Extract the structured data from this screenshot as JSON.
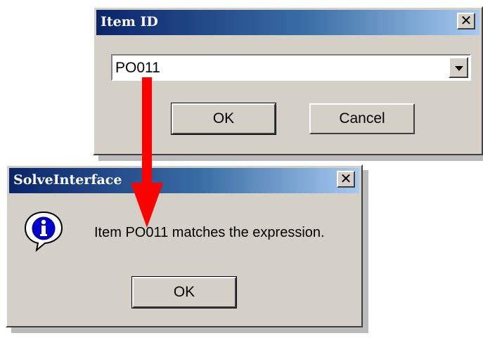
{
  "item_dialog": {
    "title": "Item ID",
    "close_label": "✕",
    "combo_value": "PO011",
    "ok_label": "OK",
    "cancel_label": "Cancel"
  },
  "message_dialog": {
    "title": "SolveInterface",
    "close_label": "✕",
    "icon": "info-icon",
    "message": "Item PO011 matches the expression.",
    "ok_label": "OK"
  },
  "colors": {
    "titlebar_start": "#0a246a",
    "titlebar_end": "#a6caf0",
    "dialog_face": "#d4d0c8",
    "arrow": "#ff0000"
  }
}
